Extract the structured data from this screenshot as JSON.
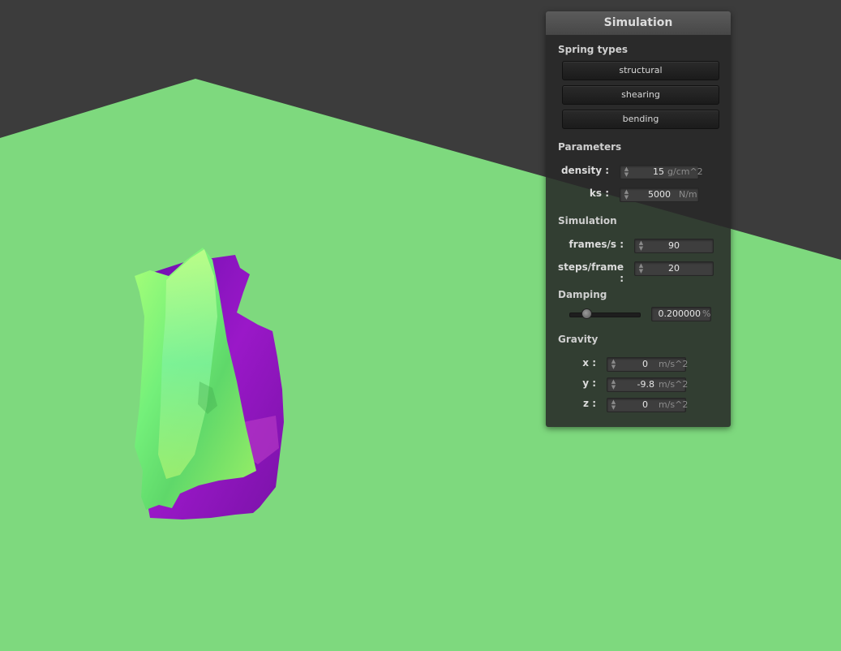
{
  "panel": {
    "title": "Simulation",
    "spring_types": {
      "title": "Spring types",
      "buttons": [
        "structural",
        "shearing",
        "bending"
      ]
    },
    "parameters": {
      "title": "Parameters",
      "density": {
        "label": "density :",
        "value": "15",
        "unit": "g/cm^2"
      },
      "ks": {
        "label": "ks :",
        "value": "5000",
        "unit": "N/m"
      }
    },
    "simulation": {
      "title": "Simulation",
      "fps": {
        "label": "frames/s :",
        "value": "90"
      },
      "steps": {
        "label": "steps/frame :",
        "value": "20"
      }
    },
    "damping": {
      "title": "Damping",
      "value": "0.200000",
      "unit": "%",
      "slider_fraction": 0.2
    },
    "gravity": {
      "title": "Gravity",
      "x": {
        "label": "x :",
        "value": "0",
        "unit": "m/s^2"
      },
      "y": {
        "label": "y :",
        "value": "-9.8",
        "unit": "m/s^2"
      },
      "z": {
        "label": "z :",
        "value": "0",
        "unit": "m/s^2"
      }
    }
  },
  "colors": {
    "background": "#3c3c3c",
    "ground_plane": "#7ed97e",
    "cloth_front": "#8cf56a",
    "cloth_back": "#8a12b8"
  }
}
